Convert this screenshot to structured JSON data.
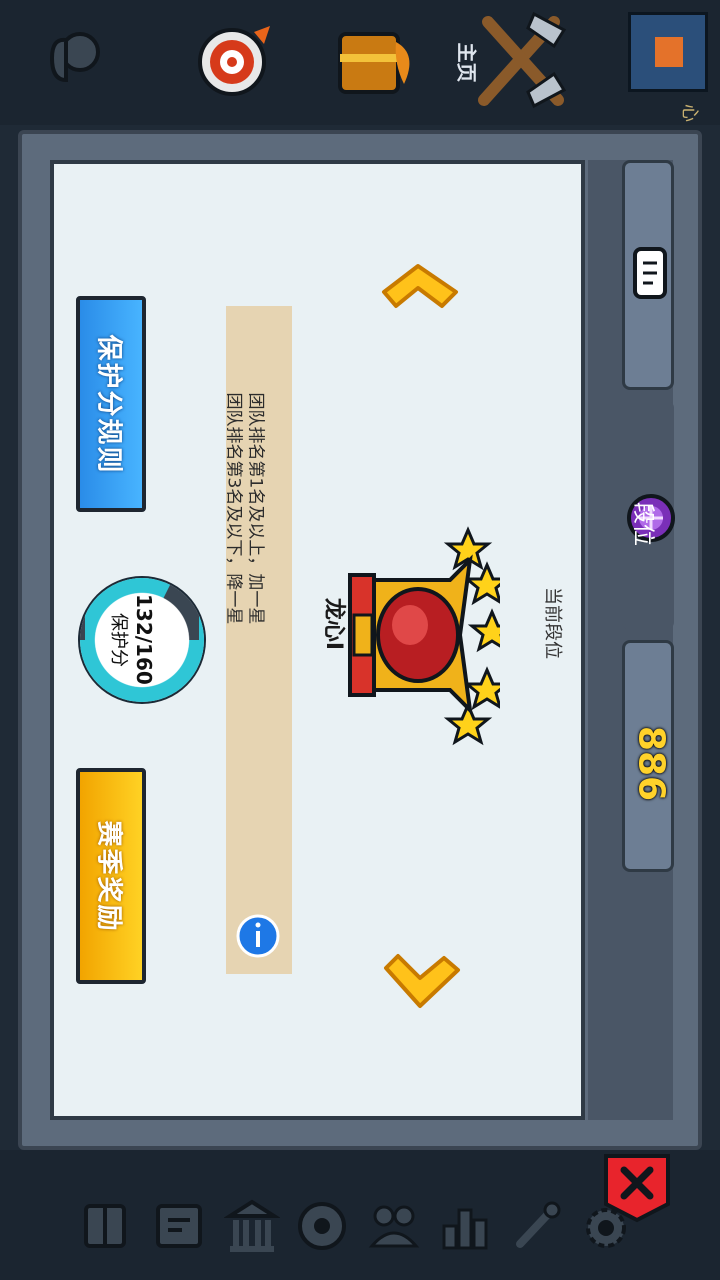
{
  "top_bar": {
    "home_label": "主页",
    "corner_label": "心"
  },
  "dialog": {
    "current_rank_label": "当前段位",
    "rank_name": "龙心I",
    "rank_stars": 5,
    "info_lines": [
      "团队排名第1名及以上，加一星",
      "团队排名第3名及以下，降一星"
    ],
    "protection": {
      "value_text": "132/160",
      "label": "保护分",
      "fraction": 0.825
    },
    "buttons": {
      "rules_label": "保护分规则",
      "rewards_label": "赛季奖励"
    },
    "tabs": {
      "rank_label": "段位",
      "count_label": "886"
    }
  },
  "colors": {
    "panel_bg": "#e9f1f4",
    "rules_button": "#2f9cf2",
    "rewards_button": "#ffc20e",
    "score_ring": "#2fc6d6",
    "close_button": "#e8242c"
  }
}
